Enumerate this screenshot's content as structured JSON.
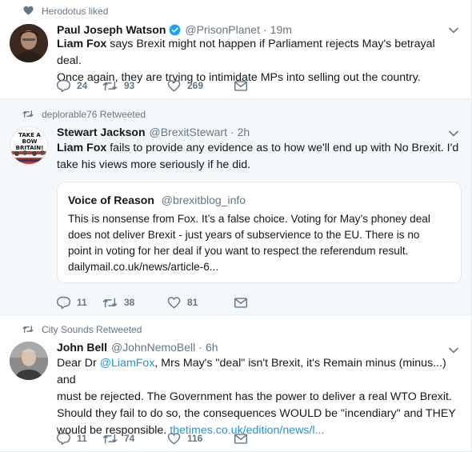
{
  "tweets": [
    {
      "context": "Herodotus liked",
      "name": "Paul Joseph Watson",
      "handle": "@PrisonPlanet",
      "time": "19m",
      "text_bold": "Liam Fox",
      "text_line1_rest": " says Brexit might not happen if Parliament rejects May's betrayal deal.",
      "text_line2": "Once again, they are trying to intimidate MPs into selling out the country.",
      "replies": "24",
      "retweets": "93",
      "likes": "269"
    },
    {
      "context": "deplorable76 Retweeted",
      "name": "Stewart Jackson",
      "handle": "@BrexitStewart",
      "time": "2h",
      "text_bold": "Liam Fox",
      "text_line1_rest": " fails to provide any evidence as to how we'll end up with No Brexit. I'd",
      "text_line2": "take his views more seriously if he did.",
      "avatar_text": "TAKE A BOW BRITAIN!",
      "quote": {
        "name": "Voice of Reason",
        "handle": "@brexitblog_info",
        "line1": "This is nonsense from Fox.  It’s a false choice. Voting for May’s phoney deal",
        "line2": "does not deliver Brexit - just years of subservience to the EU.  There is no",
        "line3": "point in voting for her deal if you want to respect the referendum result.",
        "line4": "dailymail.co.uk/news/article-6..."
      },
      "replies": "11",
      "retweets": "38",
      "likes": "81"
    },
    {
      "context": "City Sounds Retweeted",
      "name": "John Bell",
      "handle": "@JohnNemoBell",
      "time": "6h",
      "line1_a": "Dear Dr ",
      "line1_mention": "@LiamFox",
      "line1_b": ", Mrs May's \"deal\" isn't Brexit, it's Remain minus (minus...) and",
      "line2": "must be rejected. The Government has the power to deliver a real WTO Brexit.",
      "line3": "Should they fail to do so, the consequences WOULD be \"incendiary\" and THEY",
      "line4_a": "would be responsible. ",
      "line4_link": "thetimes.co.uk/edition/news/l...",
      "replies": "11",
      "retweets": "74",
      "likes": "116"
    }
  ],
  "colors": {
    "muted": "#657786",
    "link": "#1b95e0",
    "verified": "#1da1f2",
    "retweet_bg": "#f5f8fa"
  },
  "icons": {
    "like_context": "heart-icon",
    "retweet_context": "retweet-icon",
    "reply": "reply-icon",
    "retweet": "retweet-icon",
    "like": "heart-icon",
    "dm": "envelope-icon",
    "caret": "chevron-down-icon",
    "verified": "verified-badge-icon"
  }
}
